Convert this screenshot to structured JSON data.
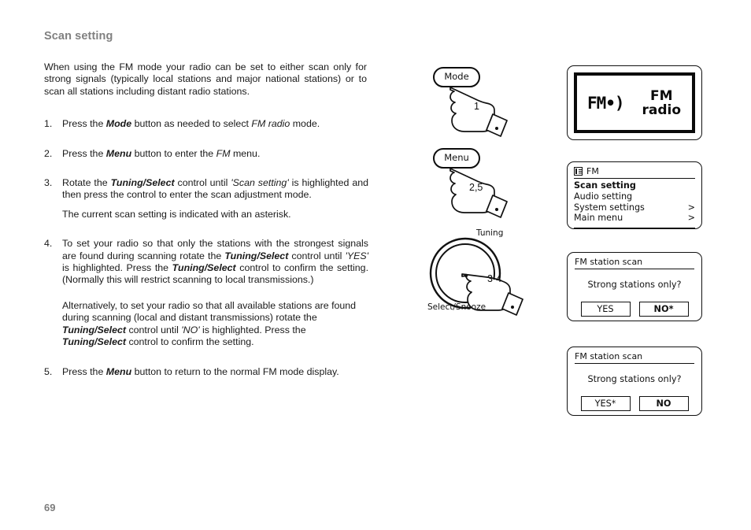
{
  "page": {
    "heading": "Scan setting",
    "number": "69",
    "intro": "When using the FM mode your radio can be set to either scan only for strong signals (typically local stations and major national stations) or to scan all stations including distant radio stations."
  },
  "steps": [
    {
      "num": "1.",
      "parts": [
        {
          "t": "Press the ",
          "s": "n"
        },
        {
          "t": "Mode",
          "s": "bi"
        },
        {
          "t": " button as needed to select ",
          "s": "n"
        },
        {
          "t": "FM radio",
          "s": "i"
        },
        {
          "t": " mode.",
          "s": "n"
        }
      ]
    },
    {
      "num": "2.",
      "parts": [
        {
          "t": "Press the ",
          "s": "n"
        },
        {
          "t": "Menu",
          "s": "bi"
        },
        {
          "t": " button to enter the ",
          "s": "n"
        },
        {
          "t": "FM",
          "s": "i"
        },
        {
          "t": " menu.",
          "s": "n"
        }
      ]
    },
    {
      "num": "3.",
      "parts": [
        {
          "t": "Rotate the ",
          "s": "n"
        },
        {
          "t": "Tuning/Select",
          "s": "bi"
        },
        {
          "t": " control until ",
          "s": "n"
        },
        {
          "t": "'Scan setting'",
          "s": "i"
        },
        {
          "t": " is highlighted and then press the control to enter the scan adjustment mode.",
          "s": "n"
        }
      ],
      "sub": "The current scan setting is indicated with an asterisk."
    },
    {
      "num": "4.",
      "parts": [
        {
          "t": "To set your radio so that only the stations with the strongest signals are found during scanning rotate the ",
          "s": "n"
        },
        {
          "t": "Tuning/Select",
          "s": "bi"
        },
        {
          "t": " control until ",
          "s": "n"
        },
        {
          "t": "'YES'",
          "s": "i"
        },
        {
          "t": " is highlighted. Press the ",
          "s": "n"
        },
        {
          "t": "Tuning/Select",
          "s": "bi"
        },
        {
          "t": " control to confirm the setting. (Normally this will restrict scanning to local transmissions.)",
          "s": "n"
        }
      ],
      "sub2_parts": [
        {
          "t": "Alternatively, to set your radio so that all available stations are found during scanning (local and distant transmissions) rotate the ",
          "s": "n"
        },
        {
          "t": "Tuning/Select",
          "s": "bi"
        },
        {
          "t": " control until ",
          "s": "n"
        },
        {
          "t": "'NO'",
          "s": "i"
        },
        {
          "t": " is highlighted. Press the ",
          "s": "n"
        },
        {
          "t": "Tuning/Select",
          "s": "bi"
        },
        {
          "t": " control to confirm the setting.",
          "s": "n"
        }
      ]
    },
    {
      "num": "5.",
      "parts": [
        {
          "t": "Press the ",
          "s": "n"
        },
        {
          "t": "Menu",
          "s": "bi"
        },
        {
          "t": " button to return to the normal FM mode display.",
          "s": "n"
        }
      ]
    }
  ],
  "illustrations": {
    "mode_button": {
      "label": "Mode",
      "step_tag": "1"
    },
    "menu_button": {
      "label": "Menu",
      "step_tag": "2,5"
    },
    "tuning_knob": {
      "label_top": "Tuning",
      "label_bottom": "Select/Snooze",
      "step_tag": "3-4"
    }
  },
  "displays": {
    "mode_display": {
      "signal_icon": "FM•)",
      "line1": "FM",
      "line2": "radio"
    },
    "menu_display": {
      "title": "FM",
      "items": [
        {
          "label": "Scan setting",
          "arrow": "",
          "selected": true
        },
        {
          "label": "Audio setting",
          "arrow": "",
          "selected": false
        },
        {
          "label": "System settings",
          "arrow": ">",
          "selected": false
        },
        {
          "label": "Main menu",
          "arrow": ">",
          "selected": false
        }
      ]
    },
    "scan_dialog_no": {
      "title": "FM station scan",
      "question": "Strong stations only?",
      "yes_label": "YES",
      "no_label": "NO*"
    },
    "scan_dialog_yes": {
      "title": "FM station scan",
      "question": "Strong stations only?",
      "yes_label": "YES*",
      "no_label": "NO"
    }
  }
}
